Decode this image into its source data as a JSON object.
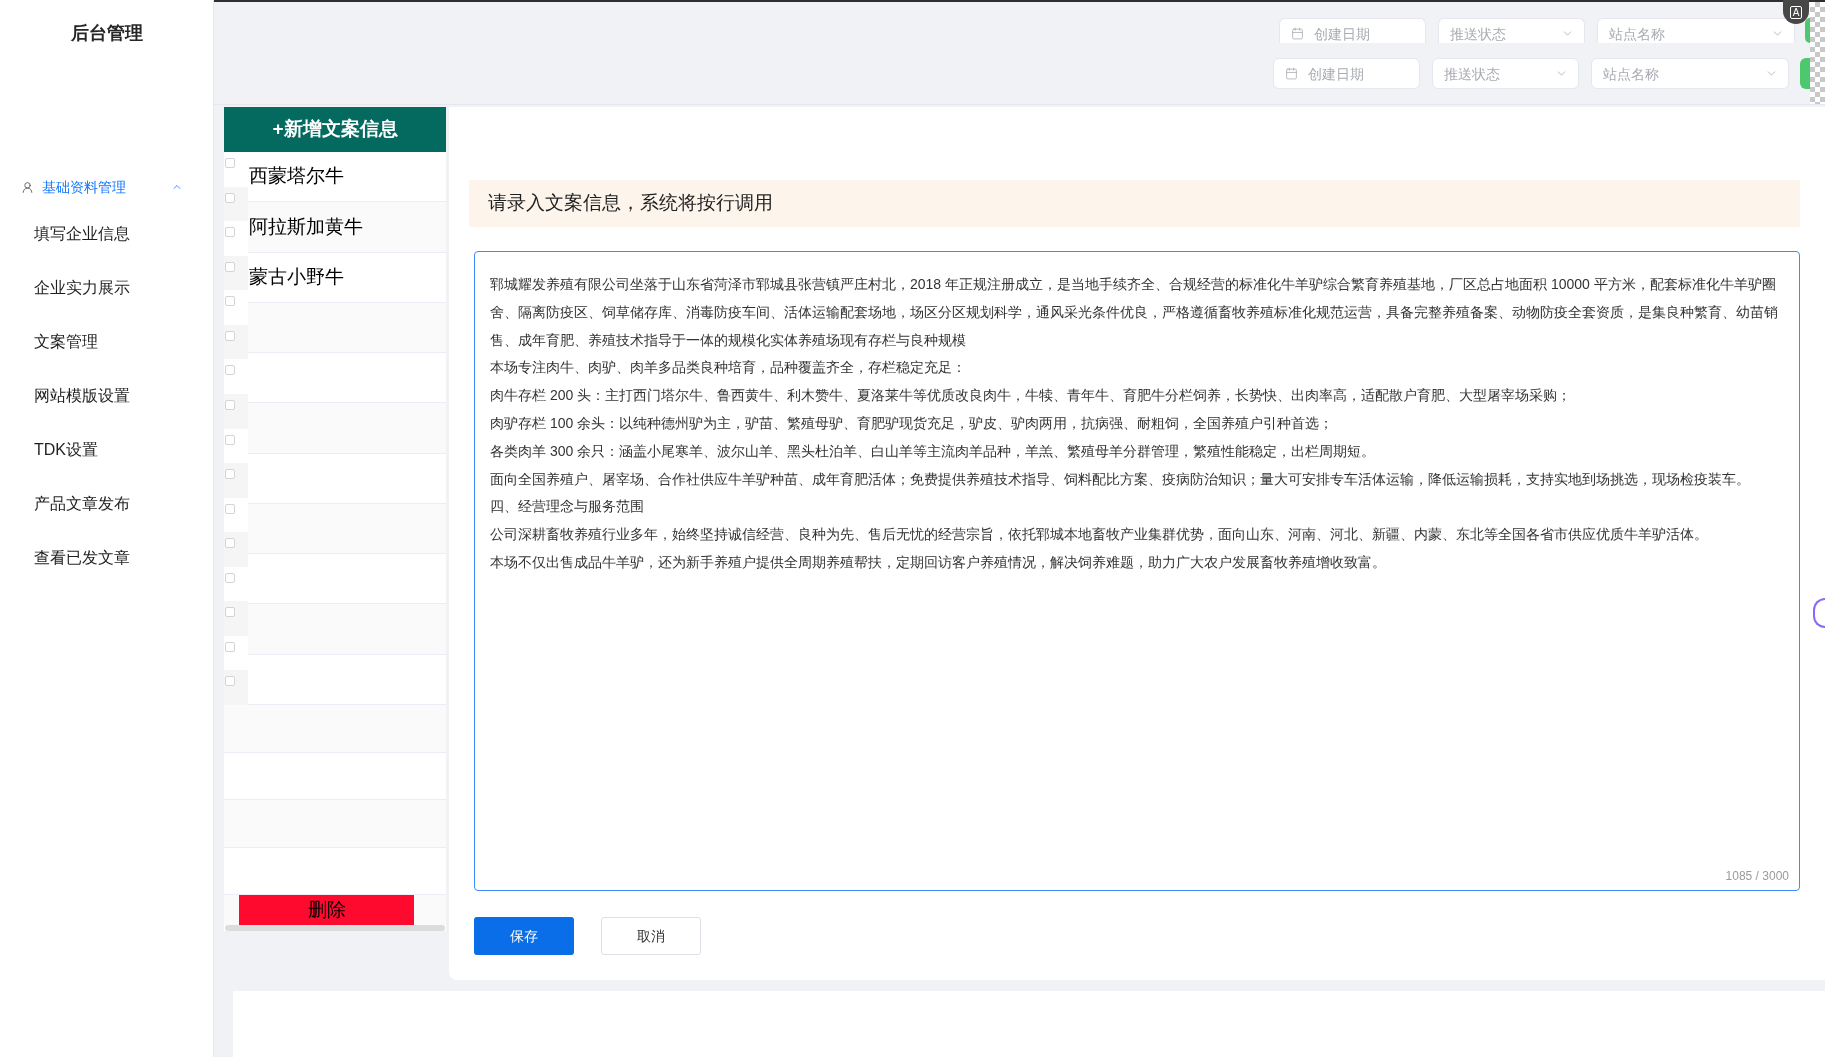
{
  "sidebar": {
    "title": "后台管理",
    "group": {
      "label": "基础资料管理",
      "expanded": true
    },
    "items": [
      {
        "label": "填写企业信息",
        "selected": false
      },
      {
        "label": "企业实力展示",
        "selected": false
      },
      {
        "label": "文案管理",
        "selected": false
      },
      {
        "label": "网站模版设置",
        "selected": false
      },
      {
        "label": "TDK设置",
        "selected": false
      },
      {
        "label": "产品文章发布",
        "selected": false
      },
      {
        "label": "查看已发文章",
        "selected": false
      }
    ]
  },
  "ocr_button": {
    "label": "A"
  },
  "filter_bars": [
    {
      "fields": [
        {
          "kind": "date",
          "placeholder": "创建日期"
        },
        {
          "kind": "select",
          "placeholder": "推送状态"
        },
        {
          "kind": "select",
          "placeholder": "站点名称"
        }
      ]
    },
    {
      "fields": [
        {
          "kind": "date",
          "placeholder": "创建日期"
        },
        {
          "kind": "select",
          "placeholder": "推送状态"
        },
        {
          "kind": "select",
          "placeholder": "站点名称"
        }
      ]
    }
  ],
  "checkbox_column": [
    {
      "checked": false
    },
    {
      "checked": false
    },
    {
      "checked": false
    },
    {
      "checked": false
    },
    {
      "checked": false
    },
    {
      "checked": false
    },
    {
      "checked": false
    },
    {
      "checked": false
    },
    {
      "checked": false
    },
    {
      "checked": false
    },
    {
      "checked": false
    },
    {
      "checked": false
    },
    {
      "checked": false
    },
    {
      "checked": false
    },
    {
      "checked": false
    },
    {
      "checked": false
    }
  ],
  "copy_list": {
    "add_button": "+新增文案信息",
    "items": [
      {
        "title": "西蒙塔尔牛",
        "selected": false
      },
      {
        "title": "阿拉斯加黄牛",
        "selected": false
      },
      {
        "title": "蒙古小野牛",
        "selected": false
      }
    ],
    "delete_button": "删除"
  },
  "editor": {
    "notice": "请录入文案信息，系统将按行调用",
    "paragraphs": [
      "郓城耀发养殖有限公司坐落于山东省菏泽市郓城县张营镇严庄村北，2018 年正规注册成立，是当地手续齐全、合规经营的标准化牛羊驴综合繁育养殖基地，厂区总占地面积 10000 平方米，配套标准化牛羊驴圈舍、隔离防疫区、饲草储存库、消毒防疫车间、活体运输配套场地，场区分区规划科学，通风采光条件优良，严格遵循畜牧养殖标准化规范运营，具备完整养殖备案、动物防疫全套资质，是集良种繁育、幼苗销售、成年育肥、养殖技术指导于一体的规模化实体养殖场现有存栏与良种规模",
      "本场专注肉牛、肉驴、肉羊多品类良种培育，品种覆盖齐全，存栏稳定充足：",
      "肉牛存栏 200 头：主打西门塔尔牛、鲁西黄牛、利木赞牛、夏洛莱牛等优质改良肉牛，牛犊、青年牛、育肥牛分栏饲养，长势快、出肉率高，适配散户育肥、大型屠宰场采购；",
      "肉驴存栏 100 余头：以纯种德州驴为主，驴苗、繁殖母驴、育肥驴现货充足，驴皮、驴肉两用，抗病强、耐粗饲，全国养殖户引种首选；",
      "各类肉羊 300 余只：涵盖小尾寒羊、波尔山羊、黑头杜泊羊、白山羊等主流肉羊品种，羊羔、繁殖母羊分群管理，繁殖性能稳定，出栏周期短。",
      "面向全国养殖户、屠宰场、合作社供应牛羊驴种苗、成年育肥活体；免费提供养殖技术指导、饲料配比方案、疫病防治知识；量大可安排专车活体运输，降低运输损耗，支持实地到场挑选，现场检疫装车。",
      "四、经营理念与服务范围",
      "公司深耕畜牧养殖行业多年，始终坚持诚信经营、良种为先、售后无忧的经营宗旨，依托郓城本地畜牧产业集群优势，面向山东、河南、河北、新疆、内蒙、东北等全国各省市供应优质牛羊驴活体。",
      "本场不仅出售成品牛羊驴，还为新手养殖户提供全周期养殖帮扶，定期回访客户养殖情况，解决饲养难题，助力广大农户发展畜牧养殖增收致富。"
    ],
    "counter": "1085 / 3000",
    "buttons": [
      {
        "kind": "primary",
        "label": "保存"
      },
      {
        "kind": "default",
        "label": "取消"
      }
    ]
  }
}
